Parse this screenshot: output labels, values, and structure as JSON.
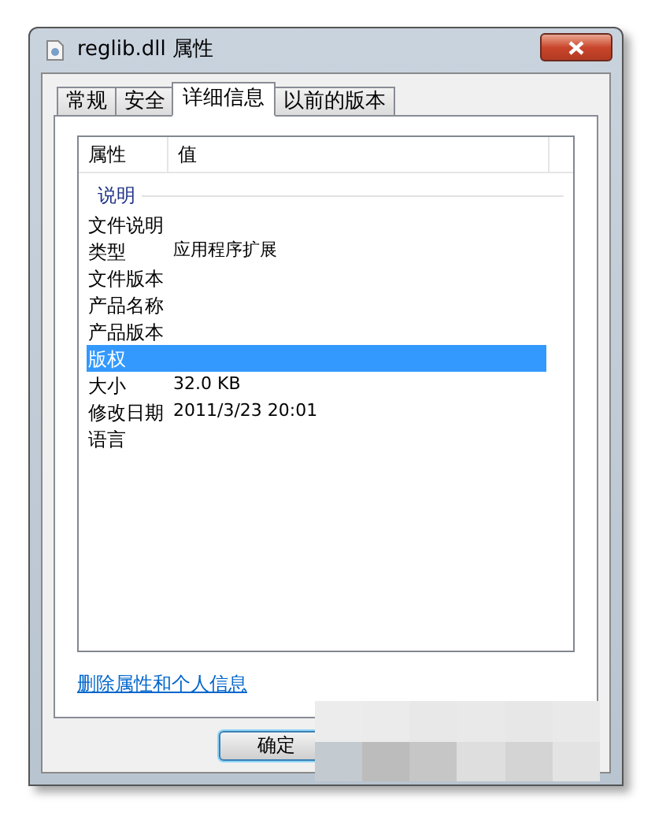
{
  "window": {
    "title": "reglib.dll 属性"
  },
  "tabs": [
    {
      "label": "常规",
      "selected": false
    },
    {
      "label": "安全",
      "selected": false
    },
    {
      "label": "详细信息",
      "selected": true
    },
    {
      "label": "以前的版本",
      "selected": false
    }
  ],
  "table": {
    "columns": [
      "属性",
      "值"
    ],
    "rows": [
      {
        "kind": "group",
        "name": "说明"
      },
      {
        "kind": "property",
        "name": "文件说明",
        "selected": false
      },
      {
        "kind": "property",
        "name": "类型",
        "value": "应用程序扩展",
        "selected": false
      },
      {
        "kind": "property",
        "name": "文件版本",
        "selected": false
      },
      {
        "kind": "property",
        "name": "产品名称",
        "selected": false
      },
      {
        "kind": "property",
        "name": "产品版本",
        "selected": false
      },
      {
        "kind": "property",
        "name": "版权",
        "selected": true
      },
      {
        "kind": "property",
        "name": "大小",
        "value": "32.0 KB",
        "selected": false
      },
      {
        "kind": "property",
        "name": "修改日期",
        "value": "2011/3/23 20:01",
        "selected": false
      },
      {
        "kind": "property",
        "name": "语言",
        "selected": false
      }
    ]
  },
  "link": "删除属性和个人信息",
  "buttons": [
    "确定"
  ]
}
